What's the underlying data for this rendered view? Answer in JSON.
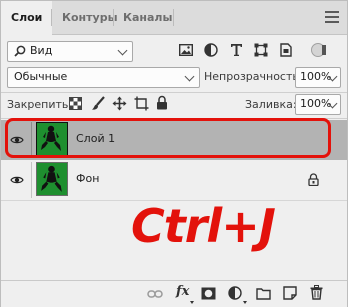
{
  "tabs": [
    "Слои",
    "Контуры",
    "Каналы"
  ],
  "filter": {
    "label": "Вид"
  },
  "blend_mode": "Обычные",
  "opacity": {
    "label": "Непрозрачность:",
    "value": "100%"
  },
  "lock": {
    "label": "Закрепить:"
  },
  "fill": {
    "label": "Заливка:",
    "value": "100%"
  },
  "layers": [
    {
      "name": "Слой 1",
      "selected": true
    },
    {
      "name": "Фон",
      "locked": true
    }
  ],
  "annotation": "Ctrl+J",
  "colors": {
    "accent": "#e3120b",
    "selected_row": "#b3b3b3",
    "thumb": "#1e8f2f"
  },
  "bottom_icons": [
    "link-icon",
    "fx-icon",
    "mask-icon",
    "adjustment-icon",
    "group-icon",
    "new-layer-icon",
    "trash-icon"
  ]
}
